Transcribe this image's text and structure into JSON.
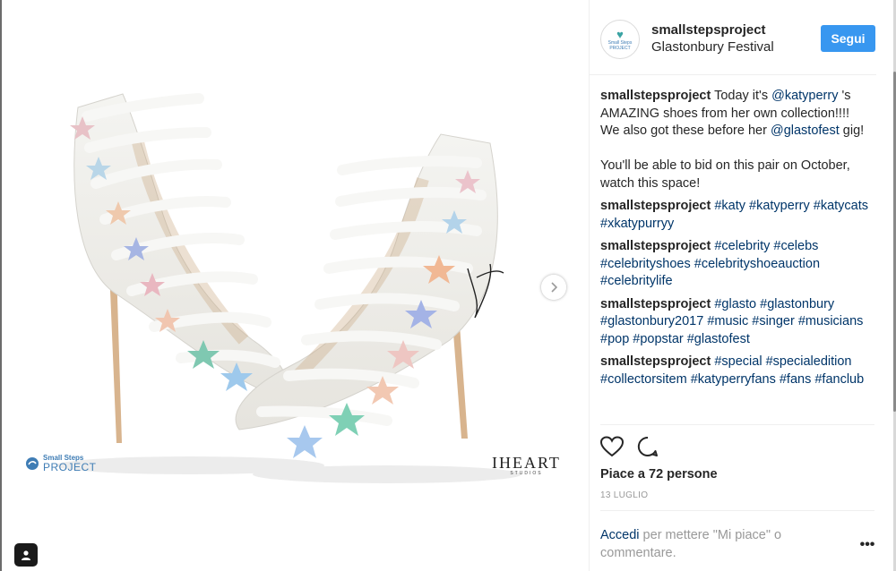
{
  "post": {
    "username": "smallstepsproject",
    "location": "Glastonbury Festival",
    "follow_label": "Segui",
    "avatar": {
      "text_line1": "Small Steps",
      "text_line2": "PROJECT"
    }
  },
  "media": {
    "brand_logo_line1": "Small Steps",
    "brand_logo_line2": "PROJECT",
    "studio_logo_big": "IHEART",
    "studio_logo_small": "STUDIOS",
    "next_icon": "chevron-right-icon",
    "tag_icon": "user-tag-icon"
  },
  "caption": {
    "author": "smallstepsproject",
    "part1": " Today it's ",
    "mention1": "@katyperry",
    "part2": " 's AMAZING shoes from her own collection!!!! We also got these before her ",
    "mention2": "@glastofest",
    "part3": " gig!",
    "part4": "You'll be able to bid on this pair on October, watch this space!"
  },
  "comments": [
    {
      "author": "smallstepsproject",
      "tags": "#katy #katyperry #katycats #xkatypurryy"
    },
    {
      "author": "smallstepsproject",
      "tags": "#celebrity #celebs #celebrityshoes #celebrityshoeauction #celebritylife"
    },
    {
      "author": "smallstepsproject",
      "tags": "#glasto #glastonbury #glastonbury2017 #music #singer #musicians #pop #popstar #glastofest"
    },
    {
      "author": "smallstepsproject",
      "tags": "#special #specialedition #collectorsitem #katyperryfans #fans #fanclub"
    }
  ],
  "actions": {
    "like_icon": "heart-icon",
    "comment_icon": "comment-icon"
  },
  "likes_text": "Piace a 72 persone",
  "date_text": "13 LUGLIO",
  "login": {
    "link": "Accedi",
    "rest": " per mettere \"Mi piace\" o commentare."
  },
  "more_label": "•••",
  "colors": {
    "accent": "#3897f0",
    "link": "#003569",
    "muted": "#999999"
  }
}
